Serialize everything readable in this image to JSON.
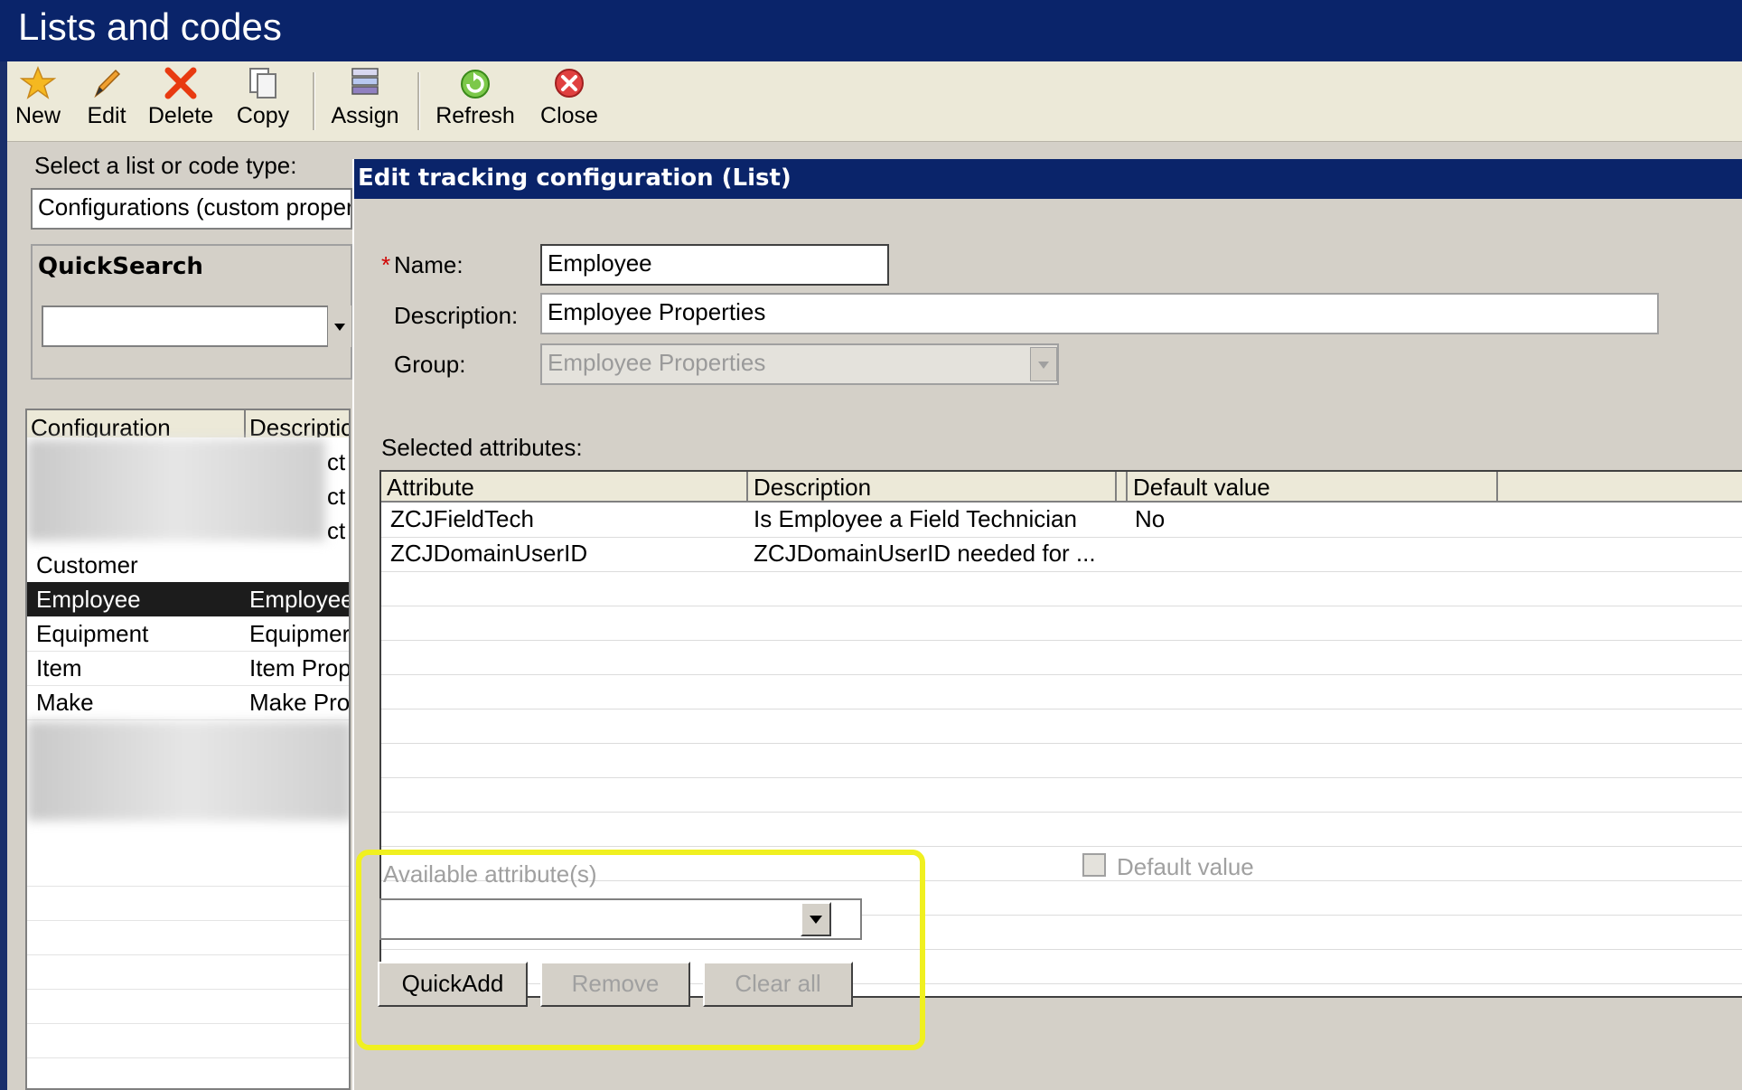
{
  "window": {
    "title": "Lists and codes"
  },
  "toolbar": {
    "buttons": [
      {
        "label": "New",
        "icon": "star-icon"
      },
      {
        "label": "Edit",
        "icon": "pencil-icon"
      },
      {
        "label": "Delete",
        "icon": "delete-x-icon"
      },
      {
        "label": "Copy",
        "icon": "copy-icon"
      },
      {
        "label": "Assign",
        "icon": "assign-icon"
      },
      {
        "label": "Refresh",
        "icon": "refresh-icon"
      },
      {
        "label": "Close",
        "icon": "close-icon"
      }
    ]
  },
  "left_panel": {
    "select_label": "Select a list or code type:",
    "select_value": "Configurations (custom proper",
    "quicksearch_label": "QuickSearch",
    "quicksearch_value": "",
    "columns": [
      "Configuration",
      "Descriptio"
    ],
    "rows": [
      {
        "name": "Customer",
        "desc": ""
      },
      {
        "name": "Employee",
        "desc": "Employee",
        "selected": true
      },
      {
        "name": "Equipment",
        "desc": "Equipmer"
      },
      {
        "name": "Item",
        "desc": "Item Prop"
      },
      {
        "name": "Make",
        "desc": "Make Pro"
      }
    ],
    "partial_desc": [
      "ct",
      "ct",
      "ct"
    ]
  },
  "dialog": {
    "title": "Edit tracking configuration (List)",
    "name_label": "Name:",
    "required_mark": "*",
    "name_value": "Employee",
    "description_label": "Description:",
    "description_value": "Employee Properties",
    "group_label": "Group:",
    "group_value": "Employee Properties",
    "selected_attributes_label": "Selected attributes:",
    "grid_columns": [
      "Attribute",
      "Description",
      "Default value"
    ],
    "grid_rows": [
      {
        "attribute": "ZCJFieldTech",
        "description": "Is Employee a Field Technician",
        "default": "No"
      },
      {
        "attribute": "ZCJDomainUserID",
        "description": "ZCJDomainUserID needed for ...",
        "default": ""
      }
    ],
    "default_value_checkbox_label": "Default value",
    "available_label": "Available attribute(s)",
    "available_value": "",
    "buttons": {
      "quickadd": "QuickAdd",
      "remove": "Remove",
      "clear_all": "Clear all"
    }
  },
  "colors": {
    "titlebar": "#0a246a",
    "highlight": "#f0f020",
    "selected_row": "#1c1c1c"
  }
}
